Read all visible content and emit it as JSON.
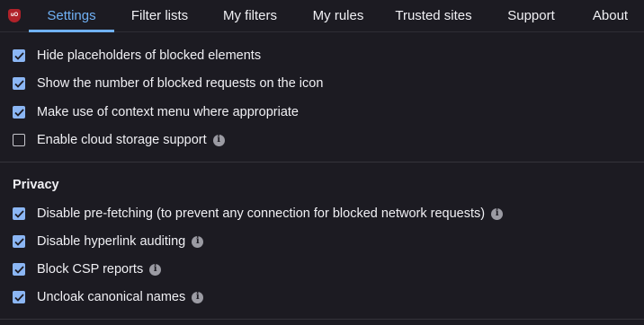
{
  "tabs": [
    {
      "label": "Settings",
      "active": true
    },
    {
      "label": "Filter lists"
    },
    {
      "label": "My filters"
    },
    {
      "label": "My rules"
    },
    {
      "label": "Trusted sites"
    },
    {
      "label": "Support"
    },
    {
      "label": "About"
    }
  ],
  "logo_text": "uO",
  "appearance_options": [
    {
      "label": "Hide placeholders of blocked elements",
      "checked": true
    },
    {
      "label": "Show the number of blocked requests on the icon",
      "checked": true
    },
    {
      "label": "Make use of context menu where appropriate",
      "checked": true
    },
    {
      "label": "Enable cloud storage support",
      "checked": false,
      "info": true
    }
  ],
  "privacy": {
    "title": "Privacy",
    "options": [
      {
        "label": "Disable pre-fetching (to prevent any connection for blocked network requests)",
        "checked": true,
        "info": true
      },
      {
        "label": "Disable hyperlink auditing",
        "checked": true,
        "info": true
      },
      {
        "label": "Block CSP reports",
        "checked": true,
        "info": true
      },
      {
        "label": "Uncloak canonical names",
        "checked": true,
        "info": true
      }
    ]
  },
  "info_glyph": "i",
  "colors": {
    "background": "#1c1b22",
    "accent": "#70b1f5",
    "checkbox": "#8bb6f4",
    "logo": "#b0222a"
  }
}
